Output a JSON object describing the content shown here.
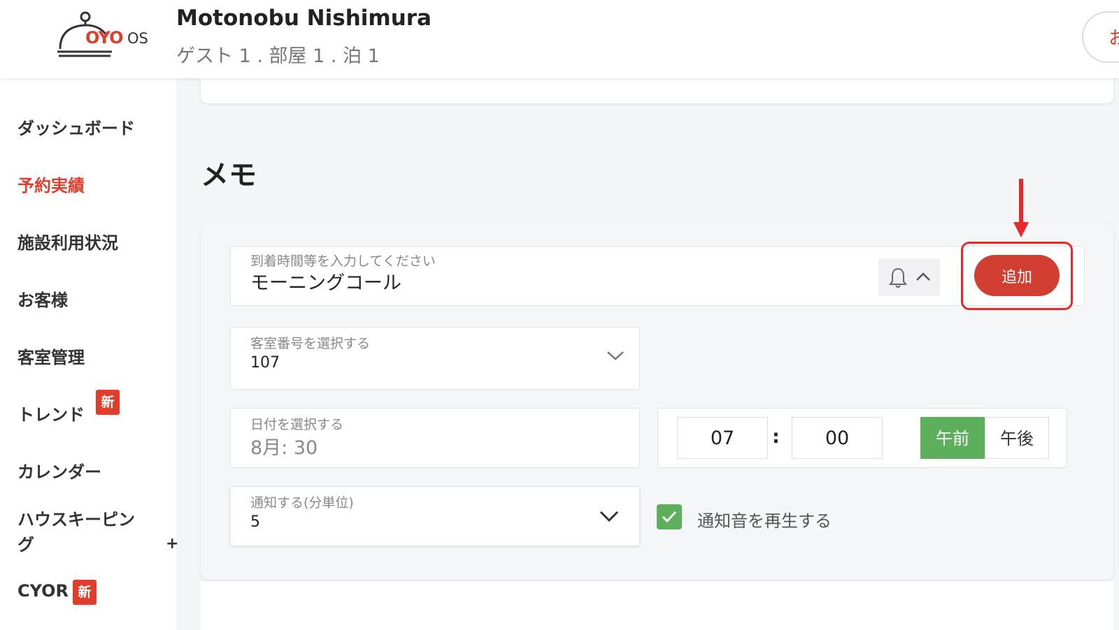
{
  "header": {
    "logo_text": "OYO",
    "logo_suffix": "OS",
    "guest_name": "Motonobu Nishimura",
    "guest_summary": "ゲスト 1 . 部屋 1 . 泊 1",
    "pill_text": "お"
  },
  "sidebar": {
    "items": [
      {
        "label": "ダッシュボード",
        "active": false
      },
      {
        "label": "予約実績",
        "active": true
      },
      {
        "label": "施設利用状況",
        "active": false
      },
      {
        "label": "お客様",
        "active": false
      },
      {
        "label": "客室管理",
        "active": false
      },
      {
        "label": "トレンド",
        "active": false,
        "badge": "新"
      },
      {
        "label": "カレンダー",
        "active": false
      },
      {
        "label": "ハウスキーピン",
        "label_line2": "グ",
        "active": false
      },
      {
        "label": "CYOR",
        "active": false,
        "badge": "新"
      }
    ],
    "expand_symbol": "+"
  },
  "main": {
    "section_title": "メモ",
    "memo": {
      "placeholder": "到着時間等を入力してください",
      "value": "モーニングコール",
      "add_label": "追加"
    },
    "room": {
      "label": "客室番号を選択する",
      "value": "107"
    },
    "date": {
      "label": "日付を選択する",
      "value": "8月: 30"
    },
    "time": {
      "hour": "07",
      "separator": ":",
      "minute": "00",
      "am_label": "午前",
      "pm_label": "午後",
      "selected": "am"
    },
    "notify": {
      "label": "通知する(分単位)",
      "value": "5"
    },
    "sound": {
      "label": "通知音を再生する",
      "checked": true
    }
  },
  "colors": {
    "brand": "#e03e2d",
    "green": "#5cb05c",
    "highlight": "#e8282b"
  },
  "icons": [
    "bell-icon",
    "chevron-up-icon",
    "chevron-down-icon",
    "check-icon",
    "arrow-down-icon",
    "plus-icon"
  ]
}
